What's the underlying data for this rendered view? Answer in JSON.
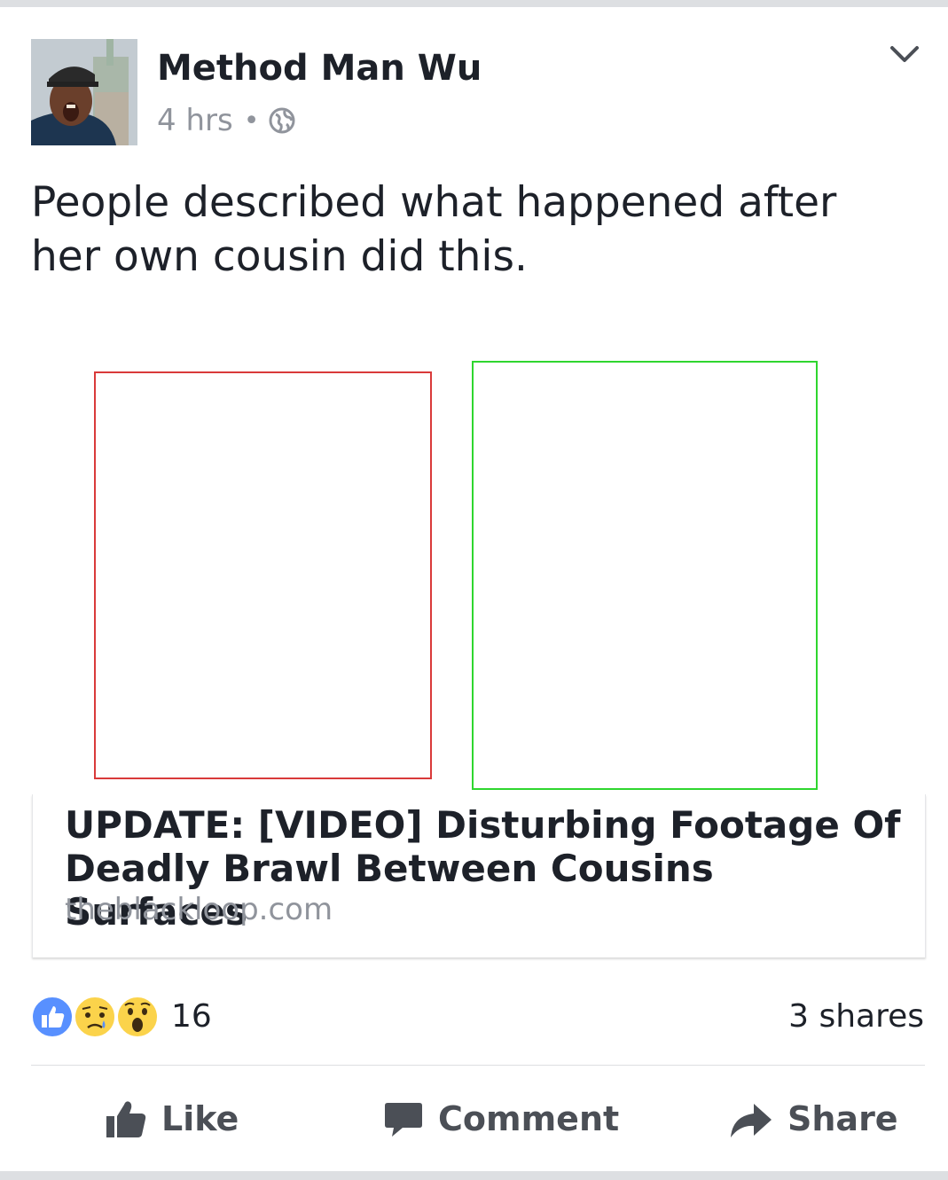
{
  "post": {
    "author": "Method Man Wu",
    "time": "4 hrs",
    "separator": "•",
    "privacy_icon": "globe-icon",
    "text": "People described what happened after her own cousin did this."
  },
  "link": {
    "title": "UPDATE: [VIDEO] Disturbing Footage Of Deadly Brawl Between Cousins Surfaces",
    "domain": "theblackloop.com"
  },
  "stats": {
    "reactions": [
      "like-icon",
      "sad-icon",
      "wow-icon"
    ],
    "reaction_count": "16",
    "shares": "3 shares"
  },
  "actions": {
    "like": "Like",
    "comment": "Comment",
    "share": "Share"
  },
  "colors": {
    "like_blue": "#5890ff",
    "emoji_yellow": "#fbd34b",
    "secondary_text": "#90949c",
    "action_text": "#4b4f56",
    "box_red": "#d93a3a",
    "box_green": "#2fd62f"
  }
}
